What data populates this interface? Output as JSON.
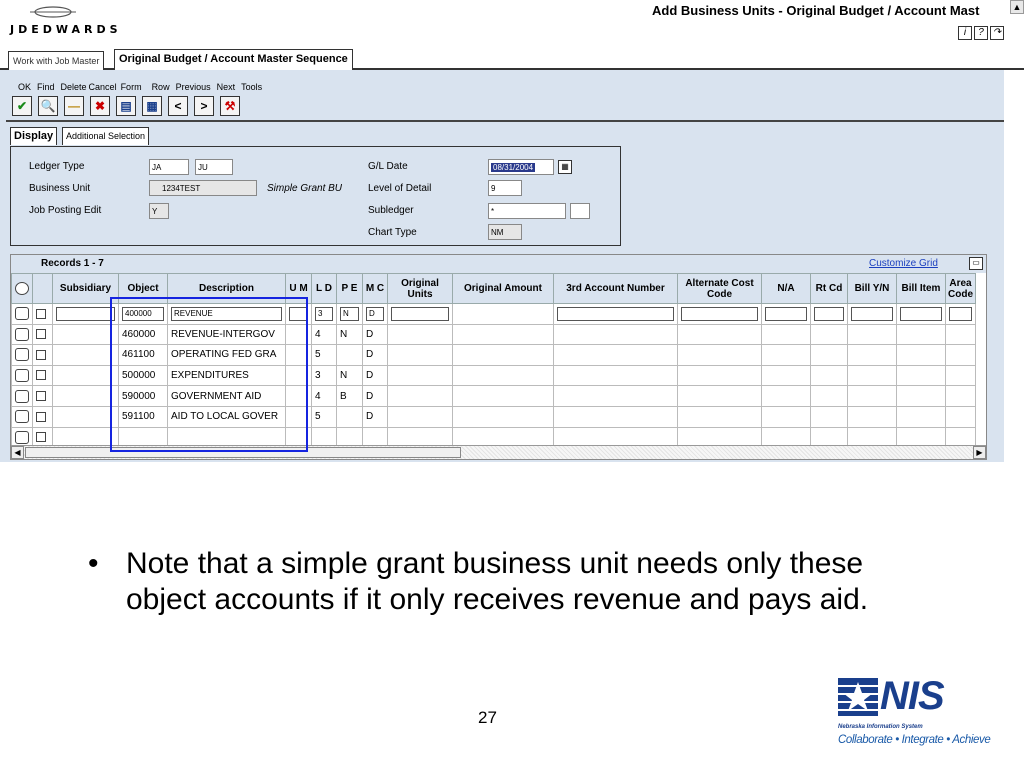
{
  "window": {
    "brand": "JDEDWARDS",
    "title": "Add Business Units - Original Budget / Account Mast",
    "help_icons": [
      "i",
      "?",
      "↷"
    ]
  },
  "tabs": [
    "Work with Job Master",
    "Original Budget / Account Master Sequence"
  ],
  "toolbar": {
    "labels": [
      "OK",
      "Find",
      "Delete",
      "Cancel",
      "Form",
      "Row",
      "Previous",
      "Next",
      "Tools"
    ],
    "icons": [
      "ok-check-icon",
      "find-icon",
      "delete-icon",
      "cancel-x-icon",
      "form-menu-icon",
      "row-menu-icon",
      "previous-icon",
      "next-icon",
      "tools-icon"
    ]
  },
  "subtabs": [
    "Display",
    "Additional Selection"
  ],
  "criteria": {
    "ledger_type_label": "Ledger Type",
    "ledger_type_1": "JA",
    "ledger_type_2": "JU",
    "business_unit_label": "Business Unit",
    "business_unit_value": "1234TEST",
    "business_unit_desc": "Simple Grant BU",
    "job_posting_label": "Job Posting Edit",
    "job_posting_value": "Y",
    "gl_date_label": "G/L Date",
    "gl_date_value": "08/31/2004",
    "level_label": "Level of Detail",
    "level_value": "9",
    "subledger_label": "Subledger",
    "subledger_value": "*",
    "subledger_type": "",
    "chart_type_label": "Chart Type",
    "chart_type_value": "NM"
  },
  "grid": {
    "records": "Records 1 - 7",
    "customize": "Customize Grid",
    "columns": [
      "Subsidiary",
      "Object",
      "Description",
      "U M",
      "L D",
      "P E",
      "M C",
      "Original Units",
      "Original Amount",
      "3rd Account Number",
      "Alternate Cost Code",
      "N/A",
      "Rt Cd",
      "Bill Y/N",
      "Bill Item",
      "Area Code"
    ],
    "rows": [
      {
        "object": "400000",
        "description": "REVENUE",
        "ld": "3",
        "pe": "N",
        "mc": "D"
      },
      {
        "object": "460000",
        "description": "REVENUE-INTERGOV",
        "ld": "4",
        "pe": "N",
        "mc": "D"
      },
      {
        "object": "461100",
        "description": "OPERATING FED GRA",
        "ld": "5",
        "pe": "",
        "mc": "D"
      },
      {
        "object": "500000",
        "description": "EXPENDITURES",
        "ld": "3",
        "pe": "N",
        "mc": "D"
      },
      {
        "object": "590000",
        "description": "GOVERNMENT AID",
        "ld": "4",
        "pe": "B",
        "mc": "D"
      },
      {
        "object": "591100",
        "description": "AID TO LOCAL GOVER",
        "ld": "5",
        "pe": "",
        "mc": "D"
      },
      {
        "object": "",
        "description": "",
        "ld": "",
        "pe": "",
        "mc": ""
      }
    ]
  },
  "slide": {
    "bullet": "Note that a simple grant business unit needs only these object accounts if it only receives revenue and pays aid.",
    "page_number": "27"
  },
  "nis_logo": {
    "word": "NIS",
    "subtitle": "Nebraska Information System",
    "tagline": "Collaborate • Integrate • Achieve"
  }
}
